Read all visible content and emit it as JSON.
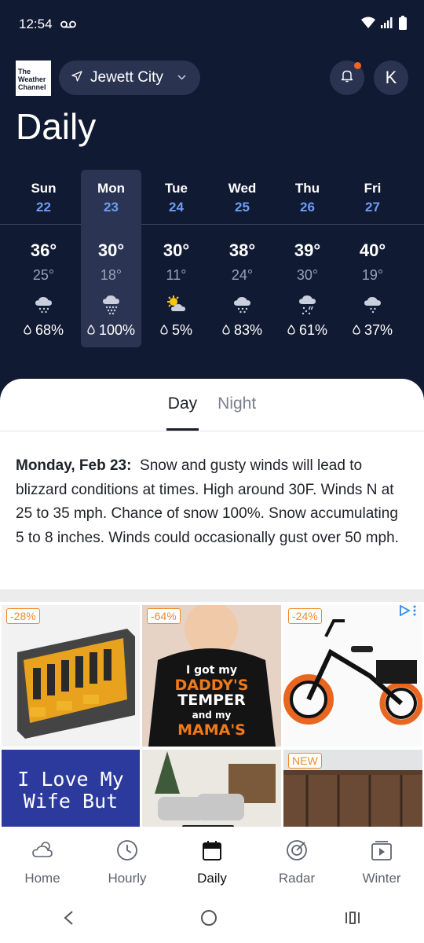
{
  "status_bar": {
    "time": "12:54"
  },
  "header": {
    "logo_lines": [
      "The",
      "Weather",
      "Channel"
    ],
    "location": "Jewett City",
    "avatar_letter": "K"
  },
  "page_title": "Daily",
  "days": [
    {
      "name": "Sun",
      "date": "22",
      "high": "36°",
      "low": "25°",
      "precip": "68%",
      "icon": "snow-cloud-icon",
      "selected": false
    },
    {
      "name": "Mon",
      "date": "23",
      "high": "30°",
      "low": "18°",
      "precip": "100%",
      "icon": "heavy-snow-icon",
      "selected": true
    },
    {
      "name": "Tue",
      "date": "24",
      "high": "30°",
      "low": "11°",
      "precip": "5%",
      "icon": "partly-sunny-icon",
      "selected": false
    },
    {
      "name": "Wed",
      "date": "25",
      "high": "38°",
      "low": "24°",
      "precip": "83%",
      "icon": "snow-cloud-icon",
      "selected": false
    },
    {
      "name": "Thu",
      "date": "26",
      "high": "39°",
      "low": "30°",
      "precip": "61%",
      "icon": "rain-snow-icon",
      "selected": false
    },
    {
      "name": "Fri",
      "date": "27",
      "high": "40°",
      "low": "19°",
      "precip": "37%",
      "icon": "snow-cloud-icon",
      "selected": false
    }
  ],
  "detail": {
    "tabs": [
      "Day",
      "Night"
    ],
    "active_tab": "Day",
    "heading": "Monday, Feb 23:",
    "text": "Snow and gusty winds will lead to blizzard conditions at times. High around 30F. Winds N at 25 to 35 mph. Chance of snow 100%. Snow accumulating 5 to 8 inches.  Winds could occasionally gust over 50 mph."
  },
  "ads": {
    "tiles": [
      {
        "badge": "-28%",
        "name": "ad-tile-tool-organizer"
      },
      {
        "badge": "-64%",
        "name": "ad-tile-kids-tshirt",
        "shirt_lines": [
          "I got my",
          "DADDY'S",
          "TEMPER",
          "and my",
          "MAMA'S"
        ]
      },
      {
        "badge": "-24%",
        "name": "ad-tile-electric-trike"
      },
      {
        "badge": "",
        "name": "ad-tile-love-wife-shirt",
        "shirt_lines": [
          "I Love My",
          "Wife But"
        ]
      },
      {
        "badge": "",
        "name": "ad-tile-living-room"
      },
      {
        "badge": "NEW",
        "name": "ad-tile-sunroom"
      }
    ]
  },
  "bottom_nav": [
    {
      "label": "Home",
      "icon": "home-cloud-icon",
      "active": false
    },
    {
      "label": "Hourly",
      "icon": "clock-icon",
      "active": false
    },
    {
      "label": "Daily",
      "icon": "calendar-icon",
      "active": true
    },
    {
      "label": "Radar",
      "icon": "radar-icon",
      "active": false
    },
    {
      "label": "Winter",
      "icon": "video-play-icon",
      "active": false
    }
  ],
  "colors": {
    "header_bg": "#111a33",
    "date_blue": "#6d9cf2",
    "selected_day_bg": "#2b3553",
    "notification_dot": "#f26522",
    "ad_badge": "#f08a24"
  }
}
